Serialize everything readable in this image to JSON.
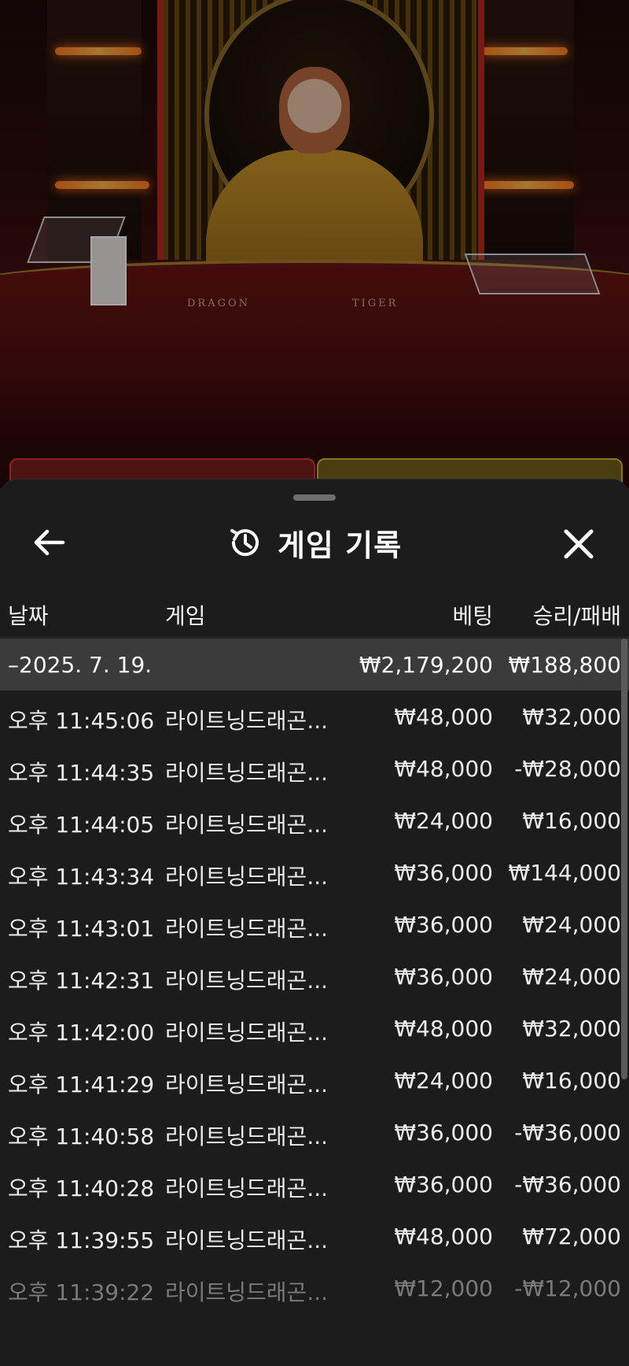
{
  "table_labels": {
    "left": "DRAGON",
    "right": "TIGER"
  },
  "sheet": {
    "title": "게임 기록",
    "icons": {
      "back": "arrow-left-icon",
      "history": "history-icon",
      "close": "close-icon"
    }
  },
  "columns": {
    "date": "날짜",
    "game": "게임",
    "bet": "베팅",
    "win_loss": "승리/패배"
  },
  "summary": {
    "date": "–2025. 7. 19.",
    "bet": "₩2,179,200",
    "win_loss": "₩188,800"
  },
  "rows": [
    {
      "time": "오후 11:45:06",
      "game": "라이트닝드래곤...",
      "bet": "₩48,000",
      "win_loss": "₩32,000"
    },
    {
      "time": "오후 11:44:35",
      "game": "라이트닝드래곤...",
      "bet": "₩48,000",
      "win_loss": "-₩28,000"
    },
    {
      "time": "오후 11:44:05",
      "game": "라이트닝드래곤...",
      "bet": "₩24,000",
      "win_loss": "₩16,000"
    },
    {
      "time": "오후 11:43:34",
      "game": "라이트닝드래곤...",
      "bet": "₩36,000",
      "win_loss": "₩144,000"
    },
    {
      "time": "오후 11:43:01",
      "game": "라이트닝드래곤...",
      "bet": "₩36,000",
      "win_loss": "₩24,000"
    },
    {
      "time": "오후 11:42:31",
      "game": "라이트닝드래곤...",
      "bet": "₩36,000",
      "win_loss": "₩24,000"
    },
    {
      "time": "오후 11:42:00",
      "game": "라이트닝드래곤...",
      "bet": "₩48,000",
      "win_loss": "₩32,000"
    },
    {
      "time": "오후 11:41:29",
      "game": "라이트닝드래곤...",
      "bet": "₩24,000",
      "win_loss": "₩16,000"
    },
    {
      "time": "오후 11:40:58",
      "game": "라이트닝드래곤...",
      "bet": "₩36,000",
      "win_loss": "-₩36,000"
    },
    {
      "time": "오후 11:40:28",
      "game": "라이트닝드래곤...",
      "bet": "₩36,000",
      "win_loss": "-₩36,000"
    },
    {
      "time": "오후 11:39:55",
      "game": "라이트닝드래곤...",
      "bet": "₩48,000",
      "win_loss": "₩72,000"
    },
    {
      "time": "오후 11:39:22",
      "game": "라이트닝드래곤...",
      "bet": "₩12,000",
      "win_loss": "-₩12,000"
    }
  ],
  "colors": {
    "sheet_bg": "#1c1c1c",
    "summary_bg": "#3b3b3b",
    "table_felt": "#5a1212",
    "accent_gold": "#c9952b"
  }
}
